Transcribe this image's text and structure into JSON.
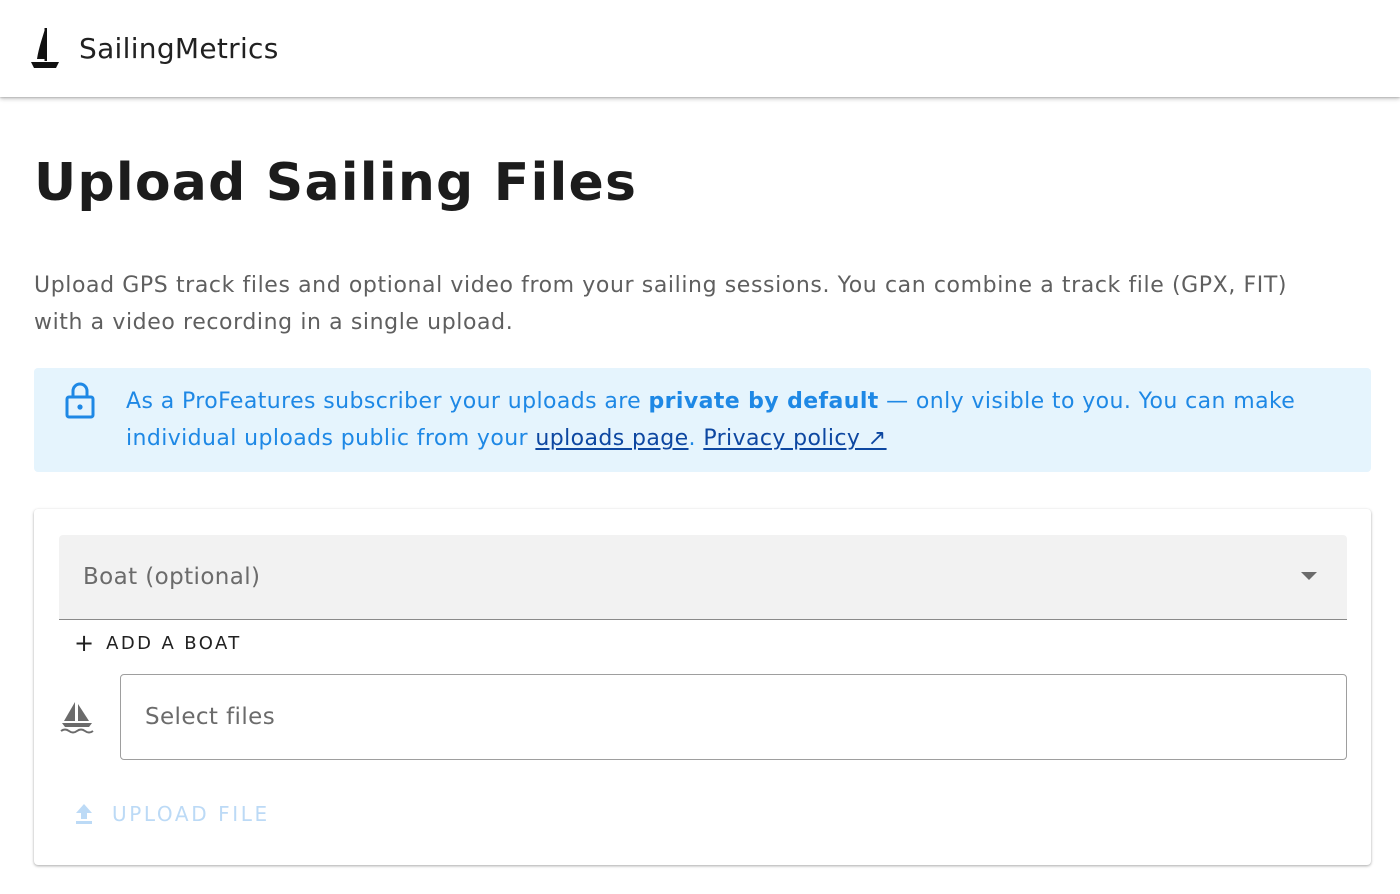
{
  "app": {
    "name": "SailingMetrics",
    "logo_icon": "sailboat-logo-icon"
  },
  "page": {
    "title": "Upload Sailing Files",
    "intro": "Upload GPS track files and optional video from your sailing sessions. You can combine a track file (GPX, FIT) with a video recording in a single upload."
  },
  "alert": {
    "icon": "lock-icon",
    "text_before": "As a ProFeatures subscriber your uploads are ",
    "text_bold": "private by default",
    "text_middle": " — only visible to you. You can make individual uploads public from your ",
    "uploads_link": "uploads page",
    "text_after": ". ",
    "privacy_link": "Privacy policy ↗",
    "colors": {
      "background": "#e5f4fd",
      "text": "#1e88e5",
      "link": "#0d47a1"
    }
  },
  "form": {
    "boat_select": {
      "label": "Boat (optional)",
      "icon": "caret-down-icon"
    },
    "add_boat": {
      "icon": "+",
      "label": "Add a boat"
    },
    "file_input": {
      "icon": "sailboat-icon",
      "placeholder": "Select files"
    },
    "upload": {
      "icon": "upload-icon",
      "label": "Upload file",
      "disabled": true,
      "color": "#bcdaf6"
    }
  }
}
